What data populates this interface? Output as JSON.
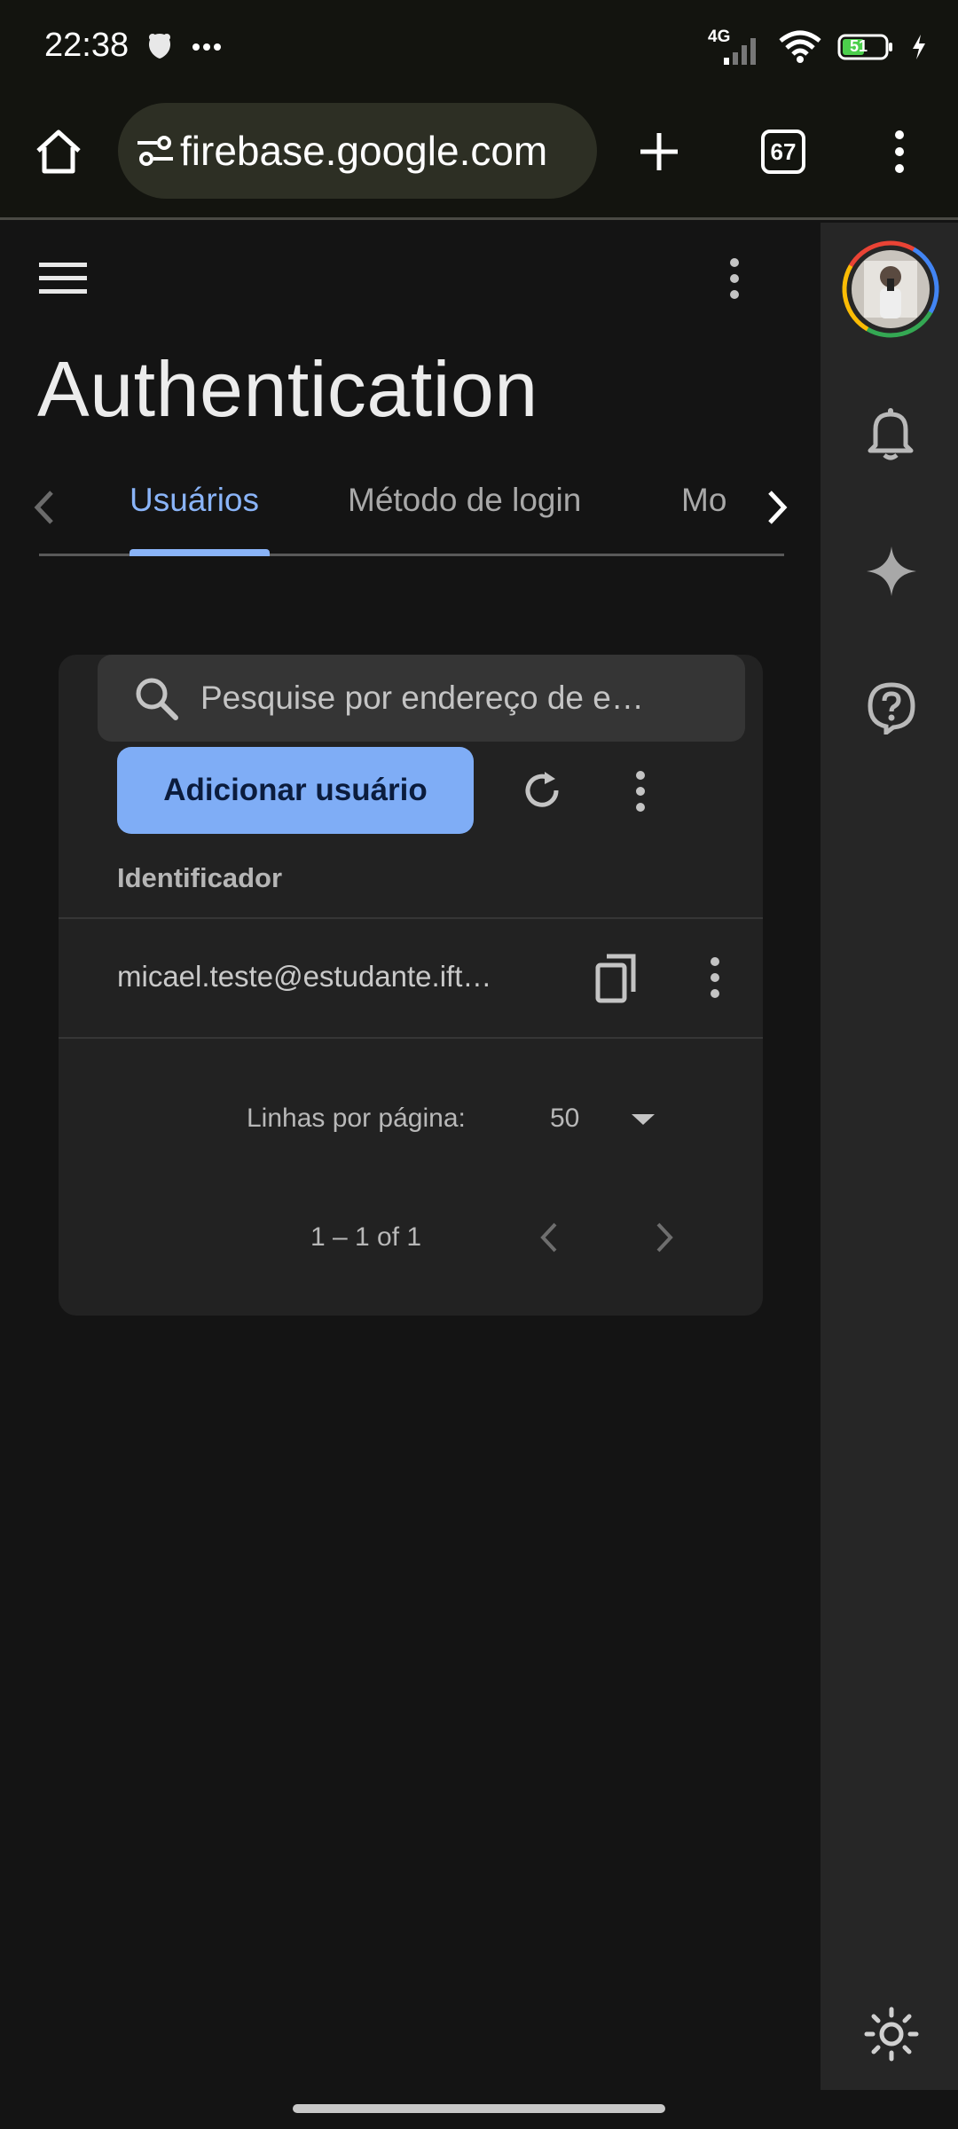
{
  "status_bar": {
    "time": "22:38",
    "network": "4G",
    "battery": "51",
    "icons": [
      "notification-app-icon",
      "more-dots-icon",
      "signal-icon",
      "wifi-icon",
      "battery-icon",
      "charging-icon"
    ]
  },
  "browser": {
    "url": "firebase.google.com",
    "tab_count": "67",
    "icons": [
      "home-icon",
      "site-settings-icon",
      "new-tab-icon",
      "tab-switcher-icon",
      "menu-icon"
    ]
  },
  "page": {
    "title": "Authentication",
    "tabs": [
      {
        "label": "Usuários",
        "active": true
      },
      {
        "label": "Método de login",
        "active": false
      },
      {
        "label": "Mo",
        "active": false
      }
    ]
  },
  "users_card": {
    "search_placeholder": "Pesquise por endereço de e…",
    "add_user_label": "Adicionar usuário",
    "column_header": "Identificador",
    "rows": [
      {
        "identifier": "micael.teste@estudante.ift…"
      }
    ],
    "pagination": {
      "rows_per_page_label": "Linhas por página:",
      "rows_per_page_value": "50",
      "range": "1 – 1 of 1"
    }
  },
  "colors": {
    "accent": "#8ab4f8",
    "primary_button": "#7fadf6",
    "background": "#141414",
    "card": "#222222"
  }
}
